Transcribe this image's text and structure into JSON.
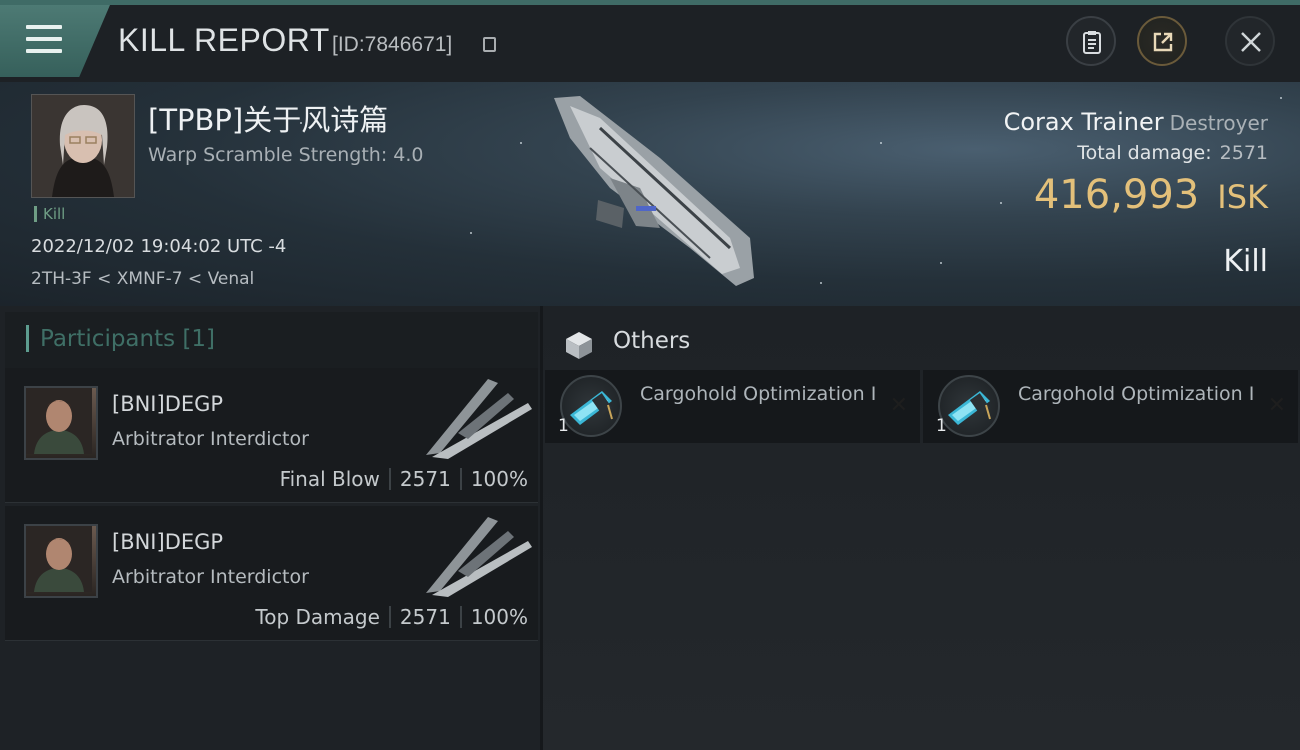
{
  "header": {
    "title": "KILL REPORT",
    "report_id": "[ID:7846671]"
  },
  "victim": {
    "name": "[TPBP]关于风诗篇",
    "warp_scramble": "Warp Scramble Strength: 4.0",
    "tag": "Kill",
    "time": "2022/12/02 19:04:02 UTC -4",
    "location": "2TH-3F < XMNF-7 < Venal",
    "ship_name": "Corax Trainer",
    "ship_class": "Destroyer",
    "total_damage_label": "Total damage:",
    "total_damage": "2571",
    "isk_value": "416,993",
    "isk_unit": "ISK",
    "outcome": "Kill"
  },
  "participants": {
    "title": "Participants [1]",
    "rows": [
      {
        "name": "[BNI]DEGP",
        "ship": "Arbitrator Interdictor",
        "role": "Final Blow",
        "damage": "2571",
        "percent": "100%"
      },
      {
        "name": "[BNI]DEGP",
        "ship": "Arbitrator Interdictor",
        "role": "Top Damage",
        "damage": "2571",
        "percent": "100%"
      }
    ]
  },
  "others": {
    "title": "Others",
    "items": [
      {
        "name": "Cargohold Optimization I",
        "qty": "1"
      },
      {
        "name": "Cargohold Optimization I",
        "qty": "1"
      }
    ]
  },
  "colors": {
    "accent": "#5d9c8f",
    "isk_gold": "#e3c07a",
    "menu_green": "#4d7a74"
  }
}
